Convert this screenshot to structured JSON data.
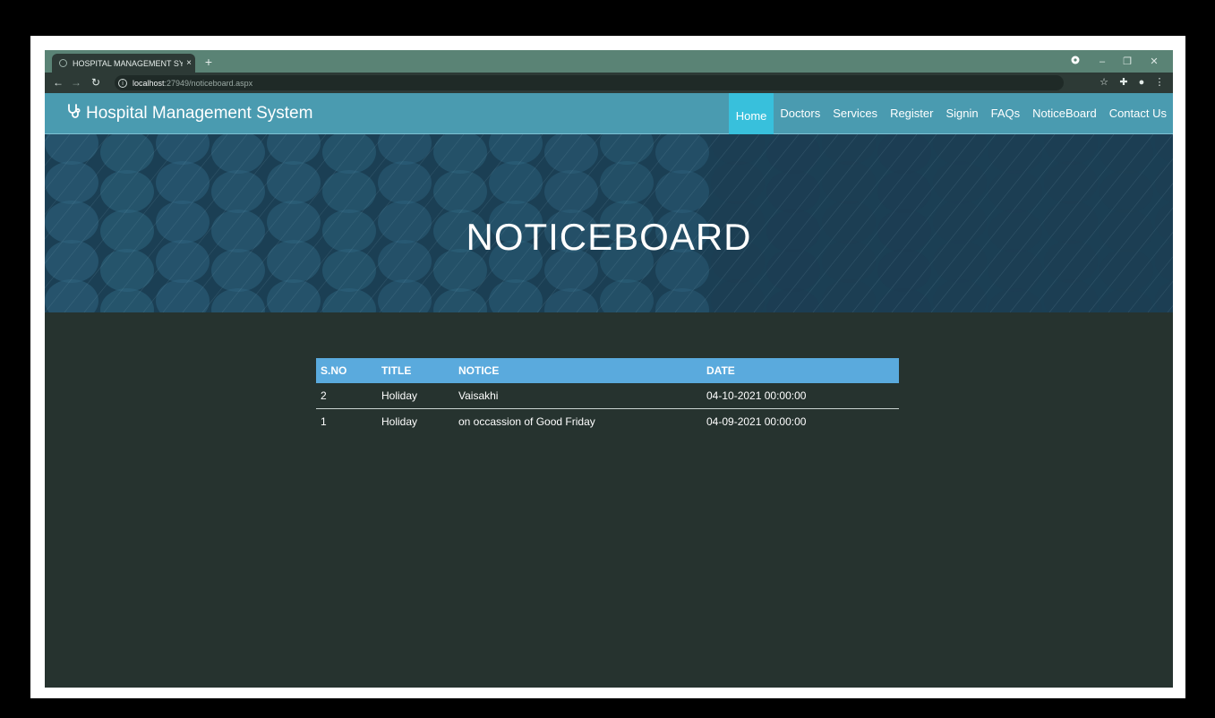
{
  "browser": {
    "tab_title": "HOSPITAL MANAGEMENT SYSTE",
    "tab_close": "×",
    "new_tab": "+",
    "address_host": "localhost",
    "address_rest": ":27949/noticeboard.aspx"
  },
  "site": {
    "brand": "Hospital Management System",
    "brand_icon": "stethoscope-icon",
    "nav": [
      {
        "label": "Home",
        "active": true
      },
      {
        "label": "Doctors"
      },
      {
        "label": "Services"
      },
      {
        "label": "Register"
      },
      {
        "label": "Signin"
      },
      {
        "label": "FAQs"
      },
      {
        "label": "NoticeBoard"
      },
      {
        "label": "Contact Us"
      }
    ]
  },
  "hero": {
    "title": "NOTICEBOARD"
  },
  "table": {
    "headers": [
      "S.NO",
      "TITLE",
      "NOTICE",
      "DATE"
    ],
    "rows": [
      [
        "2",
        "Holiday",
        "Vaisakhi",
        "04-10-2021 00:00:00"
      ],
      [
        "1",
        "Holiday",
        "on occassion of Good Friday",
        "04-09-2021 00:00:00"
      ]
    ]
  },
  "colors": {
    "nav_bg": "#4a9bb0",
    "nav_active": "#38c0dc",
    "table_header": "#5aaadd",
    "page_bg": "#26332f",
    "hero_bg": "#1b3f54"
  }
}
